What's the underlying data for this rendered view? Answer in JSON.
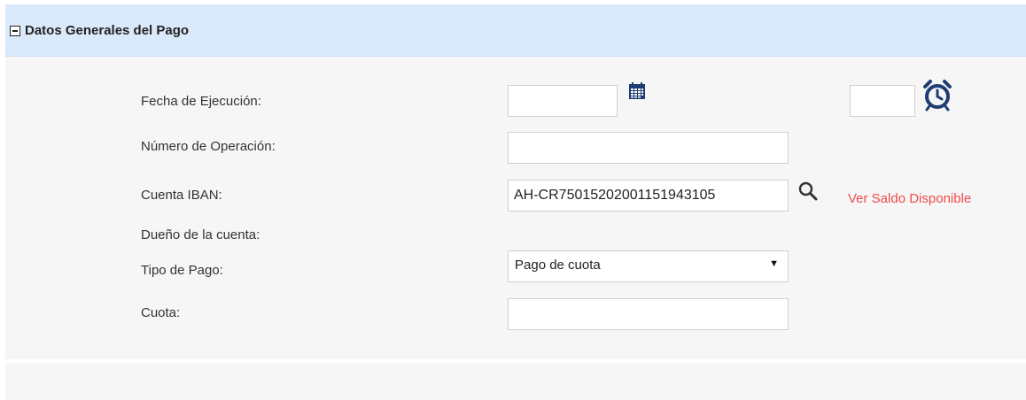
{
  "panel": {
    "title": "Datos Generales del Pago"
  },
  "form": {
    "fecha_label": "Fecha de Ejecución:",
    "fecha_value": "",
    "hora_value": "",
    "operacion_label": "Número de Operación:",
    "operacion_value": "",
    "cuenta_label": "Cuenta IBAN:",
    "cuenta_value": "AH-CR75015202001151943105",
    "ver_saldo_link": "Ver Saldo Disponible",
    "dueno_label": "Dueño de la cuenta:",
    "tipo_pago_label": "Tipo de Pago:",
    "tipo_pago_selected": "Pago de cuota",
    "cuota_label": "Cuota:",
    "cuota_value": ""
  },
  "icons": {
    "toggle": "minus-square-icon",
    "calendar": "calendar-icon",
    "clock": "alarm-clock-icon",
    "search": "search-icon",
    "dropdown": "caret-down-icon"
  },
  "colors": {
    "header_bg": "#dbeafb",
    "body_bg": "#f6f6f6",
    "icon_blue": "#1f3d73",
    "link_red": "#f04a4a"
  }
}
